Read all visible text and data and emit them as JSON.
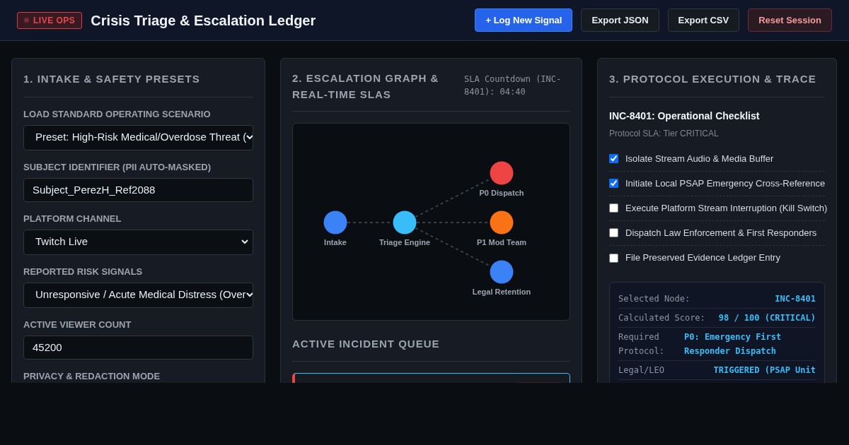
{
  "header": {
    "badge": "LIVE OPS",
    "title": "Crisis Triage & Escalation Ledger",
    "buttons": [
      {
        "label": "+ Log New Signal",
        "kind": "primary"
      },
      {
        "label": "Export JSON",
        "kind": "default"
      },
      {
        "label": "Export CSV",
        "kind": "default"
      },
      {
        "label": "Reset Session",
        "kind": "danger"
      }
    ]
  },
  "intake": {
    "title": "1. INTAKE & SAFETY PRESETS",
    "fields": [
      {
        "label": "LOAD STANDARD OPERATING SCENARIO",
        "kind": "select",
        "value": "Preset: High-Risk Medical/Overdose Threat ("
      },
      {
        "label": "SUBJECT IDENTIFIER (PII AUTO-MASKED)",
        "kind": "input",
        "value": "Subject_PerezH_Ref2088"
      },
      {
        "label": "PLATFORM CHANNEL",
        "kind": "select",
        "value": "Twitch Live"
      },
      {
        "label": "REPORTED RISK SIGNALS",
        "kind": "select",
        "value": "Unresponsive / Acute Medical Distress (Over"
      },
      {
        "label": "ACTIVE VIEWER COUNT",
        "kind": "input",
        "value": "45200"
      },
      {
        "label": "PRIVACY & REDACTION MODE",
        "kind": "label"
      }
    ]
  },
  "escalation": {
    "title": "2. ESCALATION GRAPH & REAL-TIME SLAS",
    "sla": "SLA Countdown (INC-8401): 04:40",
    "nodes": [
      {
        "label": "Intake",
        "color": "#3b82f6"
      },
      {
        "label": "Triage Engine",
        "color": "#38bdf8"
      },
      {
        "label": "P0 Dispatch",
        "color": "#ef4444"
      },
      {
        "label": "P1 Mod Team",
        "color": "#f97316"
      },
      {
        "label": "Legal Retention",
        "color": "#3b82f6"
      }
    ],
    "queue_title": "ACTIVE INCIDENT QUEUE"
  },
  "protocol": {
    "title": "3. PROTOCOL EXECUTION & TRACE",
    "checklist_title": "INC-8401: Operational Checklist",
    "subtitle": "Protocol SLA: Tier CRITICAL",
    "items": [
      {
        "label": "Isolate Stream Audio & Media Buffer",
        "checked": true
      },
      {
        "label": "Initiate Local PSAP Emergency Cross-Reference",
        "checked": true
      },
      {
        "label": "Execute Platform Stream Interruption (Kill Switch)",
        "checked": false
      },
      {
        "label": "Dispatch Law Enforcement & First Responders",
        "checked": false
      },
      {
        "label": "File Preserved Evidence Ledger Entry",
        "checked": false
      }
    ],
    "trace": [
      {
        "label": "Selected Node:",
        "value": "INC-8401"
      },
      {
        "label": "Calculated Score:",
        "value": "98 / 100 (CRITICAL)"
      },
      {
        "label": "Required Protocol:",
        "value": "P0: Emergency First Responder Dispatch"
      },
      {
        "label": "Legal/LEO",
        "value": "TRIGGERED (PSAP Unit"
      }
    ]
  }
}
